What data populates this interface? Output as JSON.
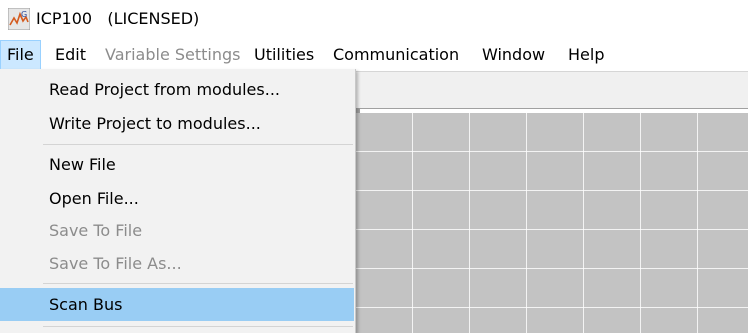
{
  "window": {
    "title": "ICP100   (LICENSED)",
    "icon": "icp-app-icon"
  },
  "menubar": {
    "items": [
      {
        "label": "File",
        "active": true
      },
      {
        "label": "Edit"
      },
      {
        "label": "Variable Settings",
        "disabled": true
      },
      {
        "label": "Utilities"
      },
      {
        "label": "Communication"
      },
      {
        "label": "Window"
      },
      {
        "label": "Help"
      }
    ]
  },
  "file_menu": {
    "items": [
      {
        "label": "Read Project from modules..."
      },
      {
        "label": "Write Project to modules..."
      },
      {
        "label": "New File"
      },
      {
        "label": "Open File..."
      },
      {
        "label": "Save To File",
        "disabled": true
      },
      {
        "label": "Save To File As...",
        "disabled": true
      },
      {
        "label": "Scan Bus",
        "highlighted": true
      }
    ]
  },
  "colors": {
    "menu_active_bg": "#cce8ff",
    "highlight_bg": "#99cdf4",
    "disabled_text": "#8c8c8c",
    "canvas_bg": "#c3c3c3"
  }
}
